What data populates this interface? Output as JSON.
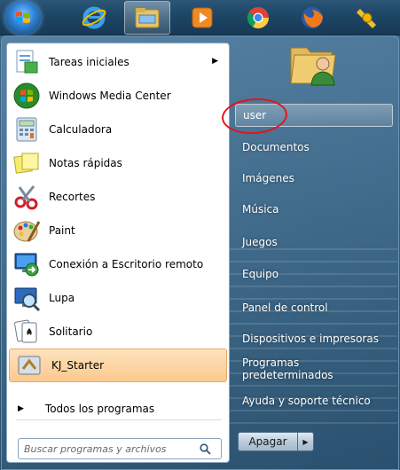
{
  "taskbar": {
    "items": [
      {
        "name": "start-orb"
      },
      {
        "name": "internet-explorer-icon"
      },
      {
        "name": "file-explorer-icon"
      },
      {
        "name": "media-player-icon"
      },
      {
        "name": "chrome-icon"
      },
      {
        "name": "firefox-icon"
      },
      {
        "name": "kj-starter-icon"
      }
    ]
  },
  "left_pane": {
    "items": [
      {
        "label": "Tareas iniciales",
        "icon": "getting-started-icon",
        "submenu": true
      },
      {
        "label": "Windows Media Center",
        "icon": "media-center-icon"
      },
      {
        "label": "Calculadora",
        "icon": "calculator-icon"
      },
      {
        "label": "Notas rápidas",
        "icon": "sticky-notes-icon"
      },
      {
        "label": "Recortes",
        "icon": "snipping-tool-icon"
      },
      {
        "label": "Paint",
        "icon": "paint-icon"
      },
      {
        "label": "Conexión a Escritorio remoto",
        "icon": "remote-desktop-icon"
      },
      {
        "label": "Lupa",
        "icon": "magnifier-icon"
      },
      {
        "label": "Solitario",
        "icon": "solitaire-icon"
      },
      {
        "label": "KJ_Starter",
        "icon": "kj-starter-icon",
        "highlighted": true
      }
    ],
    "all_programs": "Todos los programas",
    "search_placeholder": "Buscar programas y archivos"
  },
  "right_pane": {
    "user": "user",
    "links": [
      "Documentos",
      "Imágenes",
      "Música",
      "Juegos",
      "Equipo",
      "Panel de control",
      "Dispositivos e impresoras",
      "Programas predeterminados",
      "Ayuda y soporte técnico"
    ],
    "shutdown_label": "Apagar"
  },
  "colors": {
    "highlight": "#fbc98e",
    "annotation_circle": "#e0151b",
    "menu_bg": "#2f5877"
  }
}
